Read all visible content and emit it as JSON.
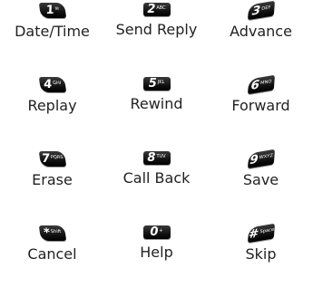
{
  "keys": [
    {
      "digit": "1",
      "sub": "✉",
      "label": "Date/Time"
    },
    {
      "digit": "2",
      "sub": "ABC",
      "label": "Send Reply"
    },
    {
      "digit": "3",
      "sub": "DEF",
      "label": "Advance"
    },
    {
      "digit": "4",
      "sub": "GHI",
      "label": "Replay"
    },
    {
      "digit": "5",
      "sub": "JKL",
      "label": "Rewind"
    },
    {
      "digit": "6",
      "sub": "MNO",
      "label": "Forward"
    },
    {
      "digit": "7",
      "sub": "PQRS",
      "label": "Erase"
    },
    {
      "digit": "8",
      "sub": "TUV",
      "label": "Call Back"
    },
    {
      "digit": "9",
      "sub": "WXYZ",
      "label": "Save"
    },
    {
      "digit": "*",
      "sub": "Shift",
      "label": "Cancel"
    },
    {
      "digit": "0",
      "sub": "+",
      "label": "Help"
    },
    {
      "digit": "#",
      "sub": "Space",
      "label": "Skip"
    }
  ]
}
